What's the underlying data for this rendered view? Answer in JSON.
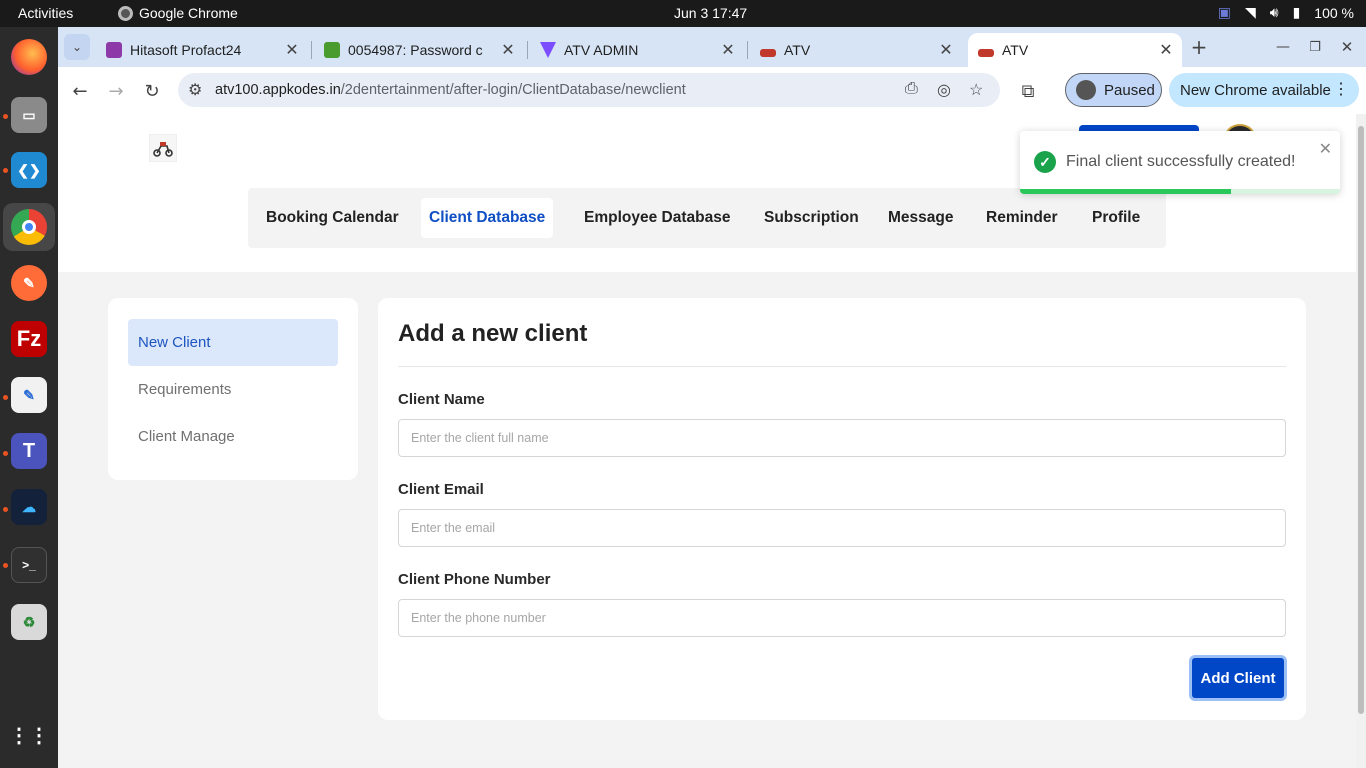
{
  "os": {
    "activities": "Activities",
    "app_name": "Google Chrome",
    "clock": "Jun 3  17:47",
    "battery": "100 %"
  },
  "browser": {
    "tabs": [
      {
        "title": "Hitasoft Profact24",
        "favicon_color": "#8d3aa8"
      },
      {
        "title": "0054987: Password c",
        "favicon_color": "#4a9c2e"
      },
      {
        "title": "ATV ADMIN",
        "favicon_color": "#7c4dff"
      },
      {
        "title": "ATV",
        "favicon_color": "#c0392b"
      },
      {
        "title": "ATV",
        "favicon_color": "#c0392b"
      }
    ],
    "active_tab": 4,
    "url_host": "atv100.appkodes.in",
    "url_path": "/2dentertainment/after-login/ClientDatabase/newclient",
    "profile_status": "Paused",
    "update_label": "New Chrome available"
  },
  "nav": {
    "items": [
      "Booking Calendar",
      "Client Database",
      "Employee Database",
      "Subscription",
      "Message",
      "Reminder",
      "Profile"
    ],
    "active": "Client Database"
  },
  "sidebar": {
    "items": [
      "New Client",
      "Requirements",
      "Client Manage"
    ],
    "active": "New Client"
  },
  "form": {
    "title": "Add a new client",
    "fields": [
      {
        "label": "Client Name",
        "placeholder": "Enter the client full name",
        "value": ""
      },
      {
        "label": "Client Email",
        "placeholder": "Enter the email",
        "value": ""
      },
      {
        "label": "Client Phone Number",
        "placeholder": "Enter the phone number",
        "value": ""
      }
    ],
    "submit_label": "Add Client"
  },
  "toast": {
    "message": "Final client successfully created!",
    "status_color": "#1aa34a",
    "progress": 0.66
  },
  "colors": {
    "accent": "#0047c8",
    "nav_active": "#0f4fc4"
  }
}
